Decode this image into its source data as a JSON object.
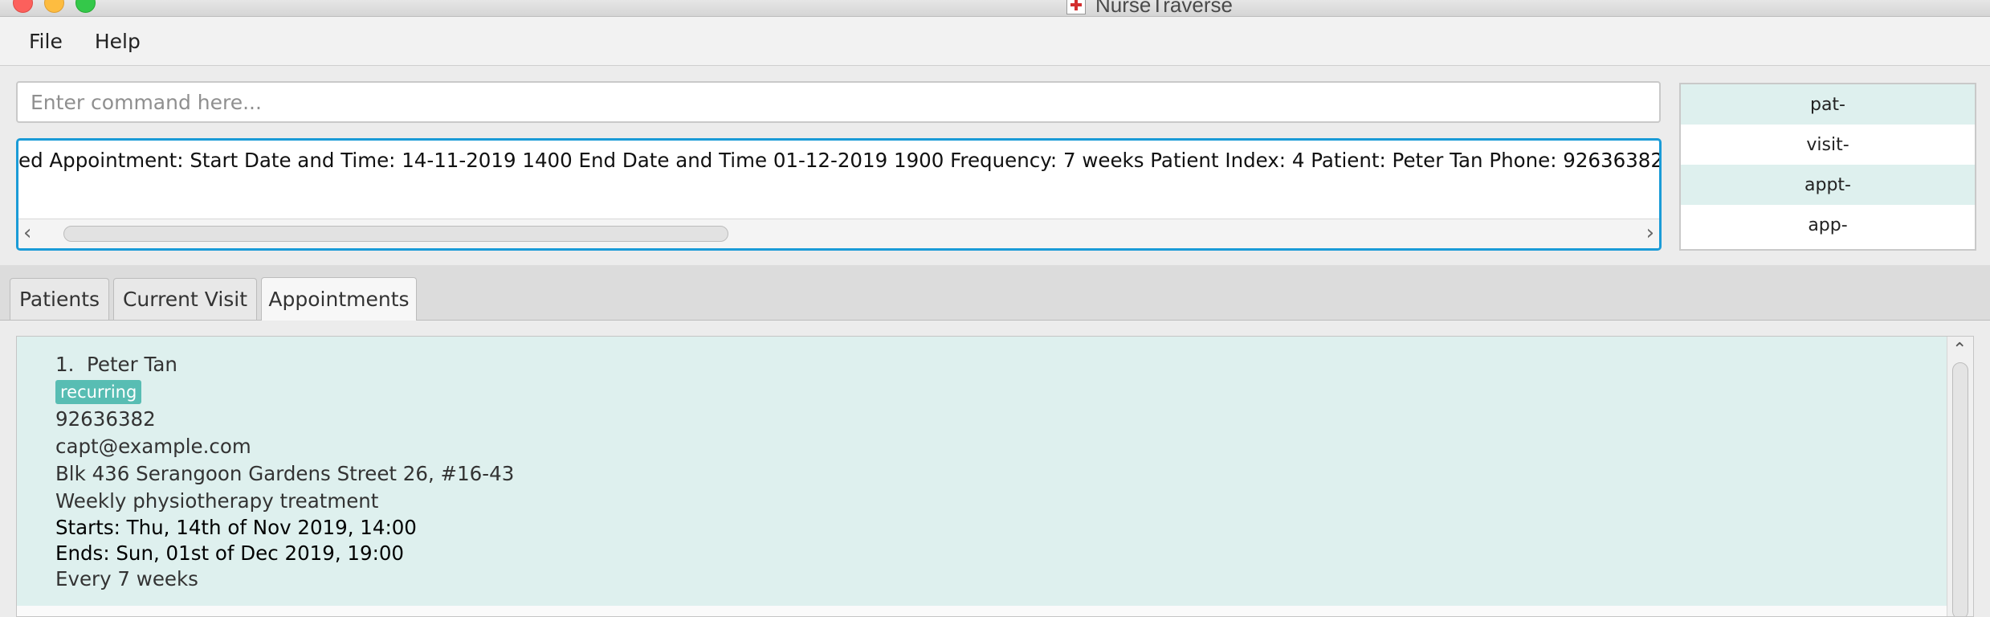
{
  "window": {
    "title": "NurseTraverse"
  },
  "menu": {
    "file": "File",
    "help": "Help"
  },
  "command": {
    "placeholder": "Enter command here...",
    "value": ""
  },
  "result": {
    "text": "ed Appointment:  Start Date and Time: 14-11-2019 1400 End Date and Time 01-12-2019 1900 Frequency: 7 weeks Patient Index: 4 Patient: Peter Tan Phone: 92636382"
  },
  "suggestions": [
    "pat-",
    "visit-",
    "appt-",
    "app-"
  ],
  "tabs": {
    "patients": "Patients",
    "current_visit": "Current Visit",
    "appointments": "Appointments",
    "selected": "Appointments"
  },
  "appointments": [
    {
      "index": "1.",
      "name": "Peter Tan",
      "tag": "recurring",
      "phone": "92636382",
      "email": "capt@example.com",
      "address": "Blk 436 Serangoon Gardens Street 26, #16-43",
      "description": "Weekly physiotherapy treatment",
      "starts": "Starts: Thu, 14th of Nov 2019, 14:00",
      "ends": "Ends: Sun, 01st of Dec 2019, 19:00",
      "frequency": "Every 7 weeks"
    }
  ],
  "colors": {
    "accent_focus": "#1a9bd7",
    "card_bg": "#def0ee",
    "tag_bg": "#58bdb3",
    "close": "#fc605c",
    "minimize": "#fdbc40",
    "maximize": "#34c84a"
  },
  "icons": {
    "app": "red-cross-icon",
    "scroll_left": "chevron-left-icon",
    "scroll_right": "chevron-right-icon",
    "scroll_up": "chevron-up-icon"
  }
}
